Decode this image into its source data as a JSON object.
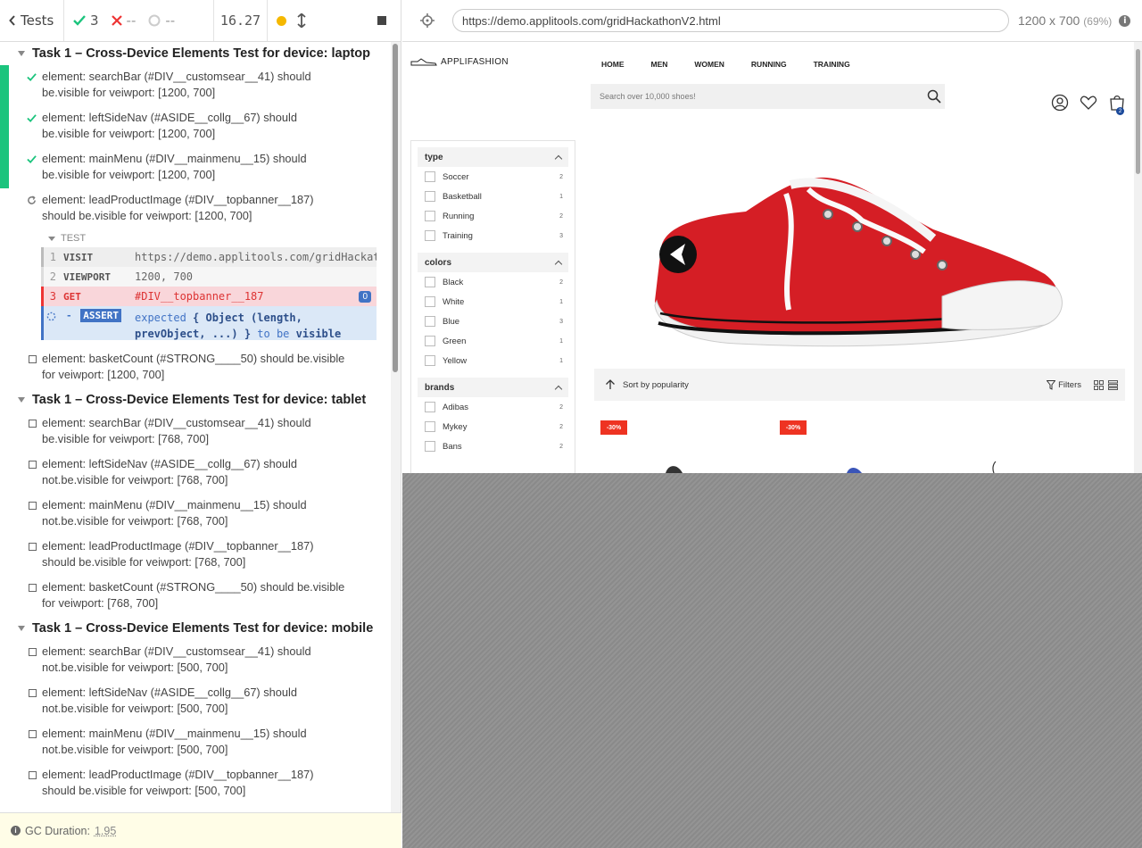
{
  "header": {
    "back_label": "Tests",
    "passed": "3",
    "failed": "--",
    "pending": "--",
    "duration": "16.27"
  },
  "url_bar": {
    "url": "https://demo.applitools.com/gridHackathonV2.html",
    "viewport": "1200 x 700",
    "scale": "(69%)"
  },
  "suites": [
    {
      "title": "Task 1 – Cross-Device Elements Test for device: laptop",
      "tests": [
        {
          "state": "passed",
          "line1": "element: searchBar (#DIV__customsear__41) should",
          "line2": "be.visible for veiwport: [1200, 700]"
        },
        {
          "state": "passed",
          "line1": "element: leftSideNav (#ASIDE__collg__67) should",
          "line2": "be.visible for veiwport: [1200, 700]"
        },
        {
          "state": "passed",
          "line1": "element: mainMenu (#DIV__mainmenu__15) should",
          "line2": "be.visible for veiwport: [1200, 700]"
        },
        {
          "state": "running",
          "line1": "element: leadProductImage (#DIV__topbanner__187)",
          "line2": "should be.visible for veiwport: [1200, 700]"
        },
        {
          "state": "pending",
          "line1": "element: basketCount (#STRONG____50) should be.visible",
          "line2": "for veiwport: [1200, 700]"
        }
      ]
    },
    {
      "title": "Task 1 – Cross-Device Elements Test for device: tablet",
      "tests": [
        {
          "state": "pending",
          "line1": "element: searchBar (#DIV__customsear__41) should",
          "line2": "be.visible for veiwport: [768, 700]"
        },
        {
          "state": "pending",
          "line1": "element: leftSideNav (#ASIDE__collg__67) should",
          "line2": "not.be.visible for veiwport: [768, 700]"
        },
        {
          "state": "pending",
          "line1": "element: mainMenu (#DIV__mainmenu__15) should",
          "line2": "not.be.visible for veiwport: [768, 700]"
        },
        {
          "state": "pending",
          "line1": "element: leadProductImage (#DIV__topbanner__187)",
          "line2": "should be.visible for veiwport: [768, 700]"
        },
        {
          "state": "pending",
          "line1": "element: basketCount (#STRONG____50) should be.visible",
          "line2": "for veiwport: [768, 700]"
        }
      ]
    },
    {
      "title": "Task 1 – Cross-Device Elements Test for device: mobile",
      "tests": [
        {
          "state": "pending",
          "line1": "element: searchBar (#DIV__customsear__41) should",
          "line2": "not.be.visible for veiwport: [500, 700]"
        },
        {
          "state": "pending",
          "line1": "element: leftSideNav (#ASIDE__collg__67) should",
          "line2": "not.be.visible for veiwport: [500, 700]"
        },
        {
          "state": "pending",
          "line1": "element: mainMenu (#DIV__mainmenu__15) should",
          "line2": "not.be.visible for veiwport: [500, 700]"
        },
        {
          "state": "pending",
          "line1": "element: leadProductImage (#DIV__topbanner__187)",
          "line2": "should be.visible for veiwport: [500, 700]"
        }
      ]
    }
  ],
  "command_log": {
    "heading": "TEST",
    "commands": [
      {
        "num": "1",
        "name": "VISIT",
        "msg": "https://demo.applitools.com/gridHackathonV2.html"
      },
      {
        "num": "2",
        "name": "VIEWPORT",
        "msg": "1200, 700"
      },
      {
        "num": "3",
        "name": "GET",
        "msg": "#DIV__topbanner__187",
        "badge": "0"
      },
      {
        "num": "-",
        "name": "ASSERT",
        "msg_expected": "expected",
        "msg_obj1": "{ Object (length,",
        "msg_obj2": "prevObject, ...) }",
        "msg_tobe": "to be",
        "msg_visible": "visible"
      }
    ]
  },
  "gc": {
    "label": "GC Duration:",
    "value": "1.95"
  },
  "aut": {
    "logo": "APPLIFASHION",
    "nav": [
      "HOME",
      "MEN",
      "WOMEN",
      "RUNNING",
      "TRAINING"
    ],
    "search_placeholder": "Search over 10,000 shoes!",
    "cart_count": "2",
    "filters": [
      {
        "title": "type",
        "items": [
          {
            "label": "Soccer",
            "count": "2"
          },
          {
            "label": "Basketball",
            "count": "1"
          },
          {
            "label": "Running",
            "count": "2"
          },
          {
            "label": "Training",
            "count": "3"
          }
        ]
      },
      {
        "title": "colors",
        "items": [
          {
            "label": "Black",
            "count": "2"
          },
          {
            "label": "White",
            "count": "1"
          },
          {
            "label": "Blue",
            "count": "3"
          },
          {
            "label": "Green",
            "count": "1"
          },
          {
            "label": "Yellow",
            "count": "1"
          }
        ]
      },
      {
        "title": "brands",
        "items": [
          {
            "label": "Adibas",
            "count": "2"
          },
          {
            "label": "Mykey",
            "count": "2"
          },
          {
            "label": "Bans",
            "count": "2"
          }
        ]
      }
    ],
    "sort_label": "Sort by popularity",
    "filters_label": "Filters",
    "sale_badges": [
      "-30%",
      "-30%"
    ]
  },
  "colors": {
    "pass": "#1bc47d",
    "fail": "#e33",
    "accent": "#4173c5"
  }
}
